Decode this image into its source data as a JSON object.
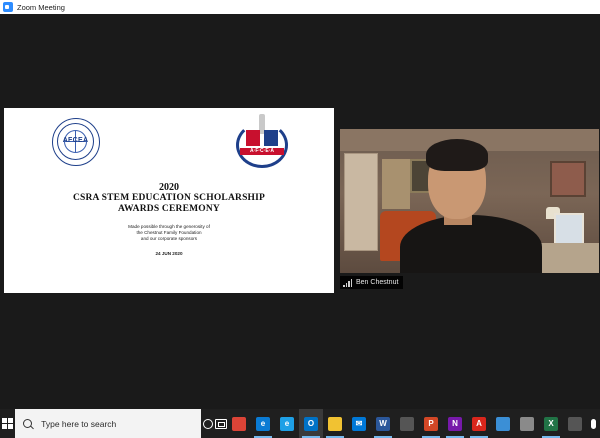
{
  "window": {
    "title": "Zoom Meeting"
  },
  "slide": {
    "logo_left_text": "AFCEA",
    "logo_right_text": "A·F·C·E·A",
    "year": "2020",
    "title_line1": "CSRA STEM EDUCATION SCHOLARSHIP",
    "title_line2": "AWARDS CEREMONY",
    "made_possible_1": "Made possible through the generosity of",
    "made_possible_2": "the Chestnut Family Foundation",
    "made_possible_3": "and our corporate sponsors",
    "date": "24 JUN 2020"
  },
  "participant": {
    "name": "Ben Chestnut"
  },
  "taskbar": {
    "search_placeholder": "Type here to search",
    "apps": [
      {
        "name": "chrome-icon",
        "glyph": "",
        "color": "#db4437"
      },
      {
        "name": "edge-icon",
        "glyph": "e",
        "color": "#0a7bd4"
      },
      {
        "name": "ie-icon",
        "glyph": "e",
        "color": "#1ea0e6"
      },
      {
        "name": "outlook-icon",
        "glyph": "O",
        "color": "#0072c6"
      },
      {
        "name": "file-explorer-icon",
        "glyph": "",
        "color": "#f1c232"
      },
      {
        "name": "mail-icon",
        "glyph": "✉",
        "color": "#0078d7"
      },
      {
        "name": "word-icon",
        "glyph": "W",
        "color": "#2b579a"
      },
      {
        "name": "photos-icon",
        "glyph": "",
        "color": "#555555"
      },
      {
        "name": "powerpoint-icon",
        "glyph": "P",
        "color": "#d24726"
      },
      {
        "name": "onenote-icon",
        "glyph": "N",
        "color": "#7719aa"
      },
      {
        "name": "pdf-icon",
        "glyph": "A",
        "color": "#d9261c"
      },
      {
        "name": "tablet-app-icon",
        "glyph": "",
        "color": "#3b8fd6"
      },
      {
        "name": "tool-icon",
        "glyph": "",
        "color": "#8a8a8a"
      },
      {
        "name": "excel-icon",
        "glyph": "X",
        "color": "#217346"
      },
      {
        "name": "teams-icon",
        "glyph": "",
        "color": "#555555"
      }
    ]
  }
}
